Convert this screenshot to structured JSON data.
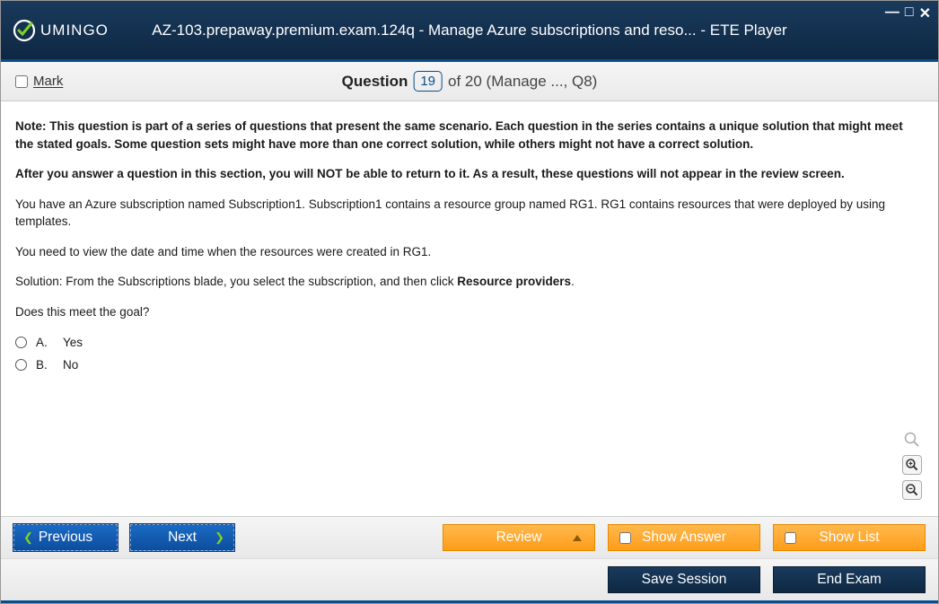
{
  "window": {
    "title": "AZ-103.prepaway.premium.exam.124q - Manage Azure subscriptions and reso... - ETE Player",
    "logo_text": "UMINGO"
  },
  "header": {
    "mark_label": "Mark",
    "question_word": "Question",
    "question_number": "19",
    "question_total": "of 20 (Manage ..., Q8)"
  },
  "question": {
    "note_bold": "Note: This question is part of a series of questions that present the same scenario. Each question in the series contains a unique solution that might meet the stated goals. Some question sets might have more than one correct solution, while others might not have a correct solution.",
    "after_bold": "After you answer a question in this section, you will NOT be able to return to it. As a result, these questions will not appear in the review screen.",
    "p1": "You have an Azure subscription named Subscription1. Subscription1 contains a resource group named RG1. RG1 contains resources that were deployed by using templates.",
    "p2": "You need to view the date and time when the resources were created in RG1.",
    "p3_pre": "Solution: From the Subscriptions blade, you select the subscription, and then click ",
    "p3_bold": "Resource providers",
    "p3_post": ".",
    "p4": "Does this meet the goal?",
    "options": [
      {
        "letter": "A.",
        "text": "Yes"
      },
      {
        "letter": "B.",
        "text": "No"
      }
    ]
  },
  "buttons": {
    "previous": "Previous",
    "next": "Next",
    "review": "Review",
    "show_answer": "Show Answer",
    "show_list": "Show List",
    "save_session": "Save Session",
    "end_exam": "End Exam"
  }
}
